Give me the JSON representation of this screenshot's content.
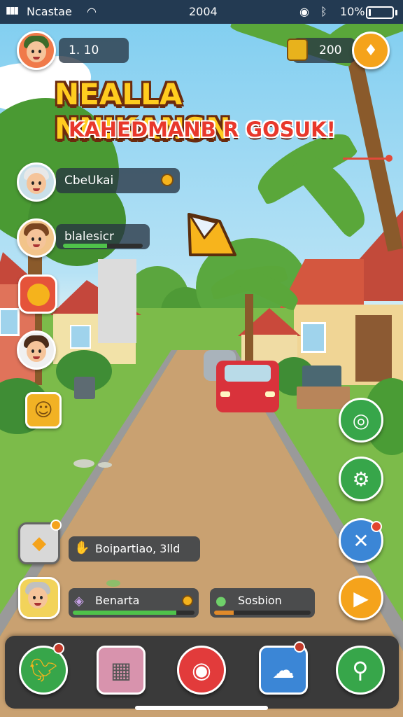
{
  "status_bar": {
    "carrier": "Ncastae",
    "time": "2004",
    "battery": "10%",
    "battery_level": 0.1
  },
  "player": {
    "level": "1. 10",
    "coins": "200"
  },
  "title": {
    "line1": "NEALLA NNIKANSN",
    "line2": "KAHEDMANB R GOSUK!"
  },
  "side_list": [
    {
      "label": "CbeUkai"
    },
    {
      "label": "blalesicr",
      "progress": 0.55
    }
  ],
  "bottom_panels": {
    "task": {
      "label": "Boipartiao, 3lld"
    },
    "bonanza": {
      "label": "Benarta",
      "progress": 0.85
    },
    "section": {
      "label": "Sosbion",
      "progress": 0.2
    }
  },
  "right_buttons": [
    "chat",
    "settings",
    "close",
    "play"
  ],
  "nav": [
    "bird",
    "inventory",
    "record",
    "ghost",
    "search"
  ],
  "colors": {
    "accent_orange": "#f5a31b",
    "accent_green": "#37a64a",
    "accent_blue": "#3b86d6",
    "accent_red": "#e23b3b",
    "panel": "#283442"
  }
}
